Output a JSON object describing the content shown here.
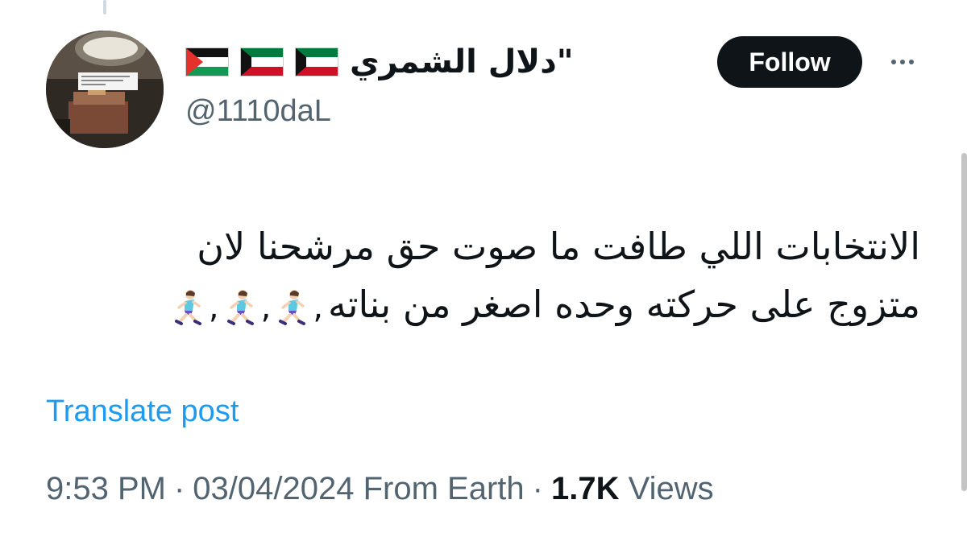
{
  "tweet": {
    "author": {
      "display_name": "\"دلال الشمري",
      "handle": "@1110daL",
      "flag_icons": [
        "kuwait-flag-icon",
        "kuwait-flag-icon",
        "palestine-flag-icon"
      ]
    },
    "follow_label": "Follow",
    "text_lines": [
      "الانتخابات اللي طافت ما صوت حق مرشحنا لان",
      "متزوج على حركته وحده اصغر من بناته"
    ],
    "emoji_icon": "woman-running-icon",
    "emoji_count": 3,
    "translate_label": "Translate post",
    "time": "9:53 PM",
    "date": "03/04/2024",
    "source": "From Earth",
    "separator": "·",
    "views_count": "1.7K",
    "views_label": "Views"
  },
  "colors": {
    "text": "#0f1419",
    "secondary_text": "#536471",
    "link": "#1d9bf0",
    "button_bg": "#0f1419"
  }
}
